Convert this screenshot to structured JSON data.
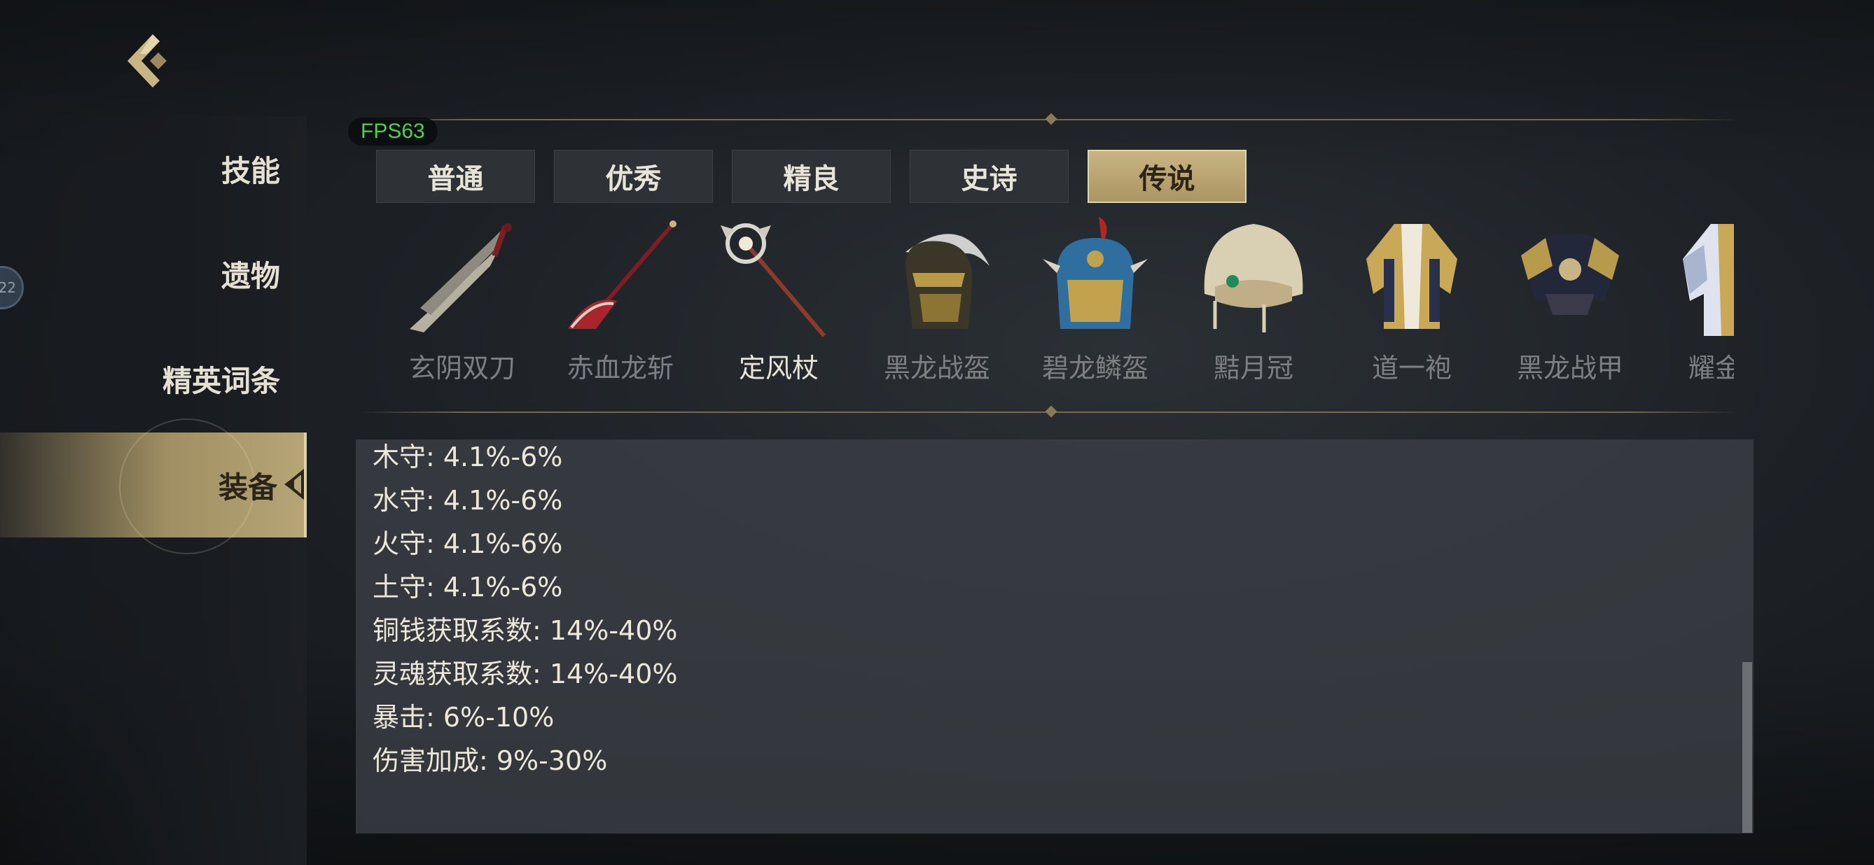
{
  "overlay": {
    "fps": "FPS63",
    "avatar_badge": "22"
  },
  "sidebar": {
    "items": [
      {
        "label": "技能",
        "active": false
      },
      {
        "label": "遗物",
        "active": false
      },
      {
        "label": "精英词条",
        "active": false
      },
      {
        "label": "装备",
        "active": true
      }
    ]
  },
  "rarity_tabs": [
    {
      "label": "普通",
      "active": false
    },
    {
      "label": "优秀",
      "active": false
    },
    {
      "label": "精良",
      "active": false
    },
    {
      "label": "史诗",
      "active": false
    },
    {
      "label": "传说",
      "active": true
    }
  ],
  "equipment": [
    {
      "name": "玄阴双刀",
      "icon": "twin-blades-icon",
      "selected": false
    },
    {
      "name": "赤血龙斩",
      "icon": "glaive-icon",
      "selected": false
    },
    {
      "name": "定风杖",
      "icon": "staff-icon",
      "selected": true
    },
    {
      "name": "黑龙战盔",
      "icon": "plumed-helmet-icon",
      "selected": false
    },
    {
      "name": "碧龙鳞盔",
      "icon": "dragon-helmet-icon",
      "selected": false
    },
    {
      "name": "黠月冠",
      "icon": "crown-hat-icon",
      "selected": false
    },
    {
      "name": "道一袍",
      "icon": "robe-icon",
      "selected": false
    },
    {
      "name": "黑龙战甲",
      "icon": "armor-icon",
      "selected": false
    },
    {
      "name": "耀金羽",
      "icon": "gold-robe-icon",
      "selected": false
    }
  ],
  "attributes": [
    "木守: 4.1%-6%",
    "水守: 4.1%-6%",
    "火守: 4.1%-6%",
    "土守: 4.1%-6%",
    "铜钱获取系数: 14%-40%",
    "灵魂获取系数: 14%-40%",
    "暴击: 6%-10%",
    "伤害加成: 9%-30%"
  ],
  "colors": {
    "accent_gold": "#b6a577",
    "fps_green": "#4bd34b",
    "panel_bg": "#3a3e44"
  }
}
